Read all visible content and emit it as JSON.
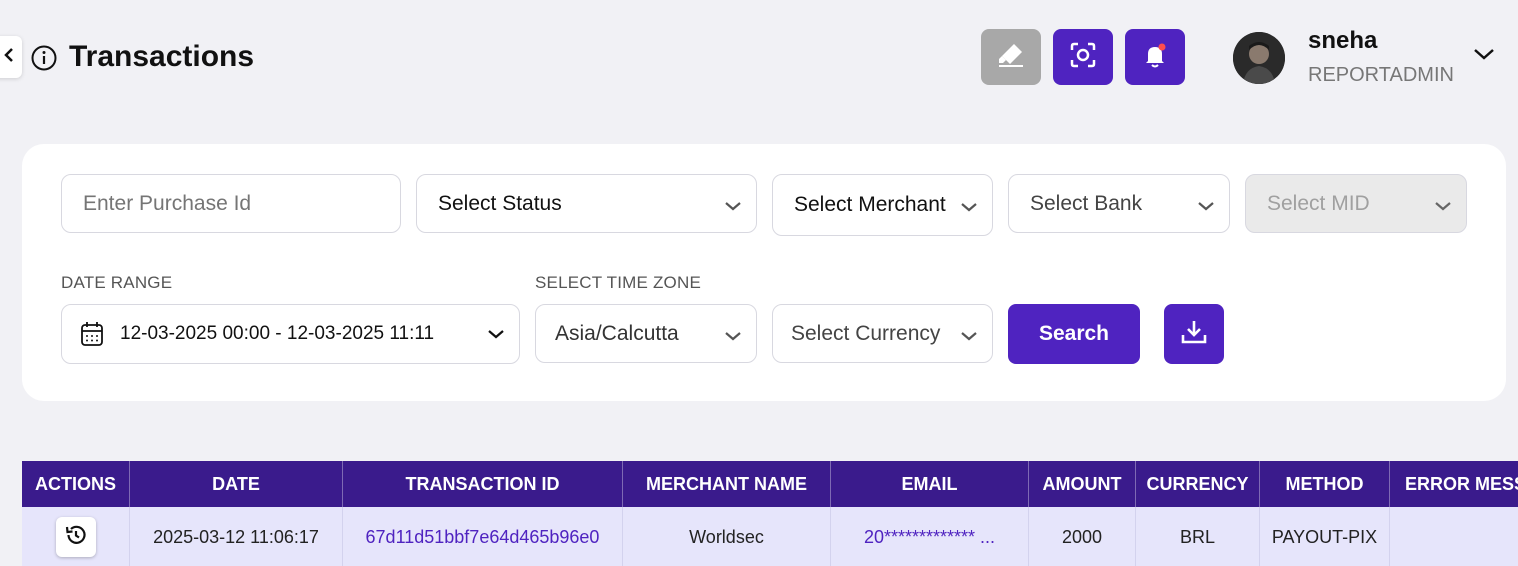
{
  "header": {
    "title": "Transactions",
    "icons": {
      "back": "chevron-left-icon",
      "info": "info-icon",
      "eraser": "eraser-icon",
      "scan": "scan-icon",
      "bell": "bell-icon"
    },
    "user": {
      "name": "sneha",
      "role": "REPORTADMIN"
    },
    "colors": {
      "accent": "#4f23c0",
      "disabled": "#a8a8a8",
      "notification": "#ff4d4f"
    }
  },
  "filters": {
    "purchase_id": {
      "placeholder": "Enter Purchase Id",
      "value": ""
    },
    "status": {
      "value": "Select Status"
    },
    "merchant": {
      "value": "Select Merchant"
    },
    "bank": {
      "value": "Select Bank"
    },
    "mid": {
      "value": "Select MID"
    },
    "date_range": {
      "label": "DATE RANGE",
      "value": "12-03-2025 00:00 - 12-03-2025 11:11"
    },
    "time_zone": {
      "label": "SELECT TIME ZONE",
      "value": "Asia/Calcutta"
    },
    "currency": {
      "value": "Select Currency"
    },
    "search_label": "Search"
  },
  "table": {
    "columns": [
      "ACTIONS",
      "DATE",
      "TRANSACTION ID",
      "MERCHANT NAME",
      "EMAIL",
      "AMOUNT",
      "CURRENCY",
      "METHOD",
      "ERROR MESS"
    ],
    "rows": [
      {
        "date": "2025-03-12 11:06:17",
        "transaction_id": "67d11d51bbf7e64d465b96e0",
        "merchant_name": "Worldsec",
        "email": "20************* ...",
        "amount": "2000",
        "currency": "BRL",
        "method": "PAYOUT-PIX",
        "error_message": ""
      }
    ],
    "header_color": "#3a1b8c",
    "row_color": "#e6e5fb"
  }
}
